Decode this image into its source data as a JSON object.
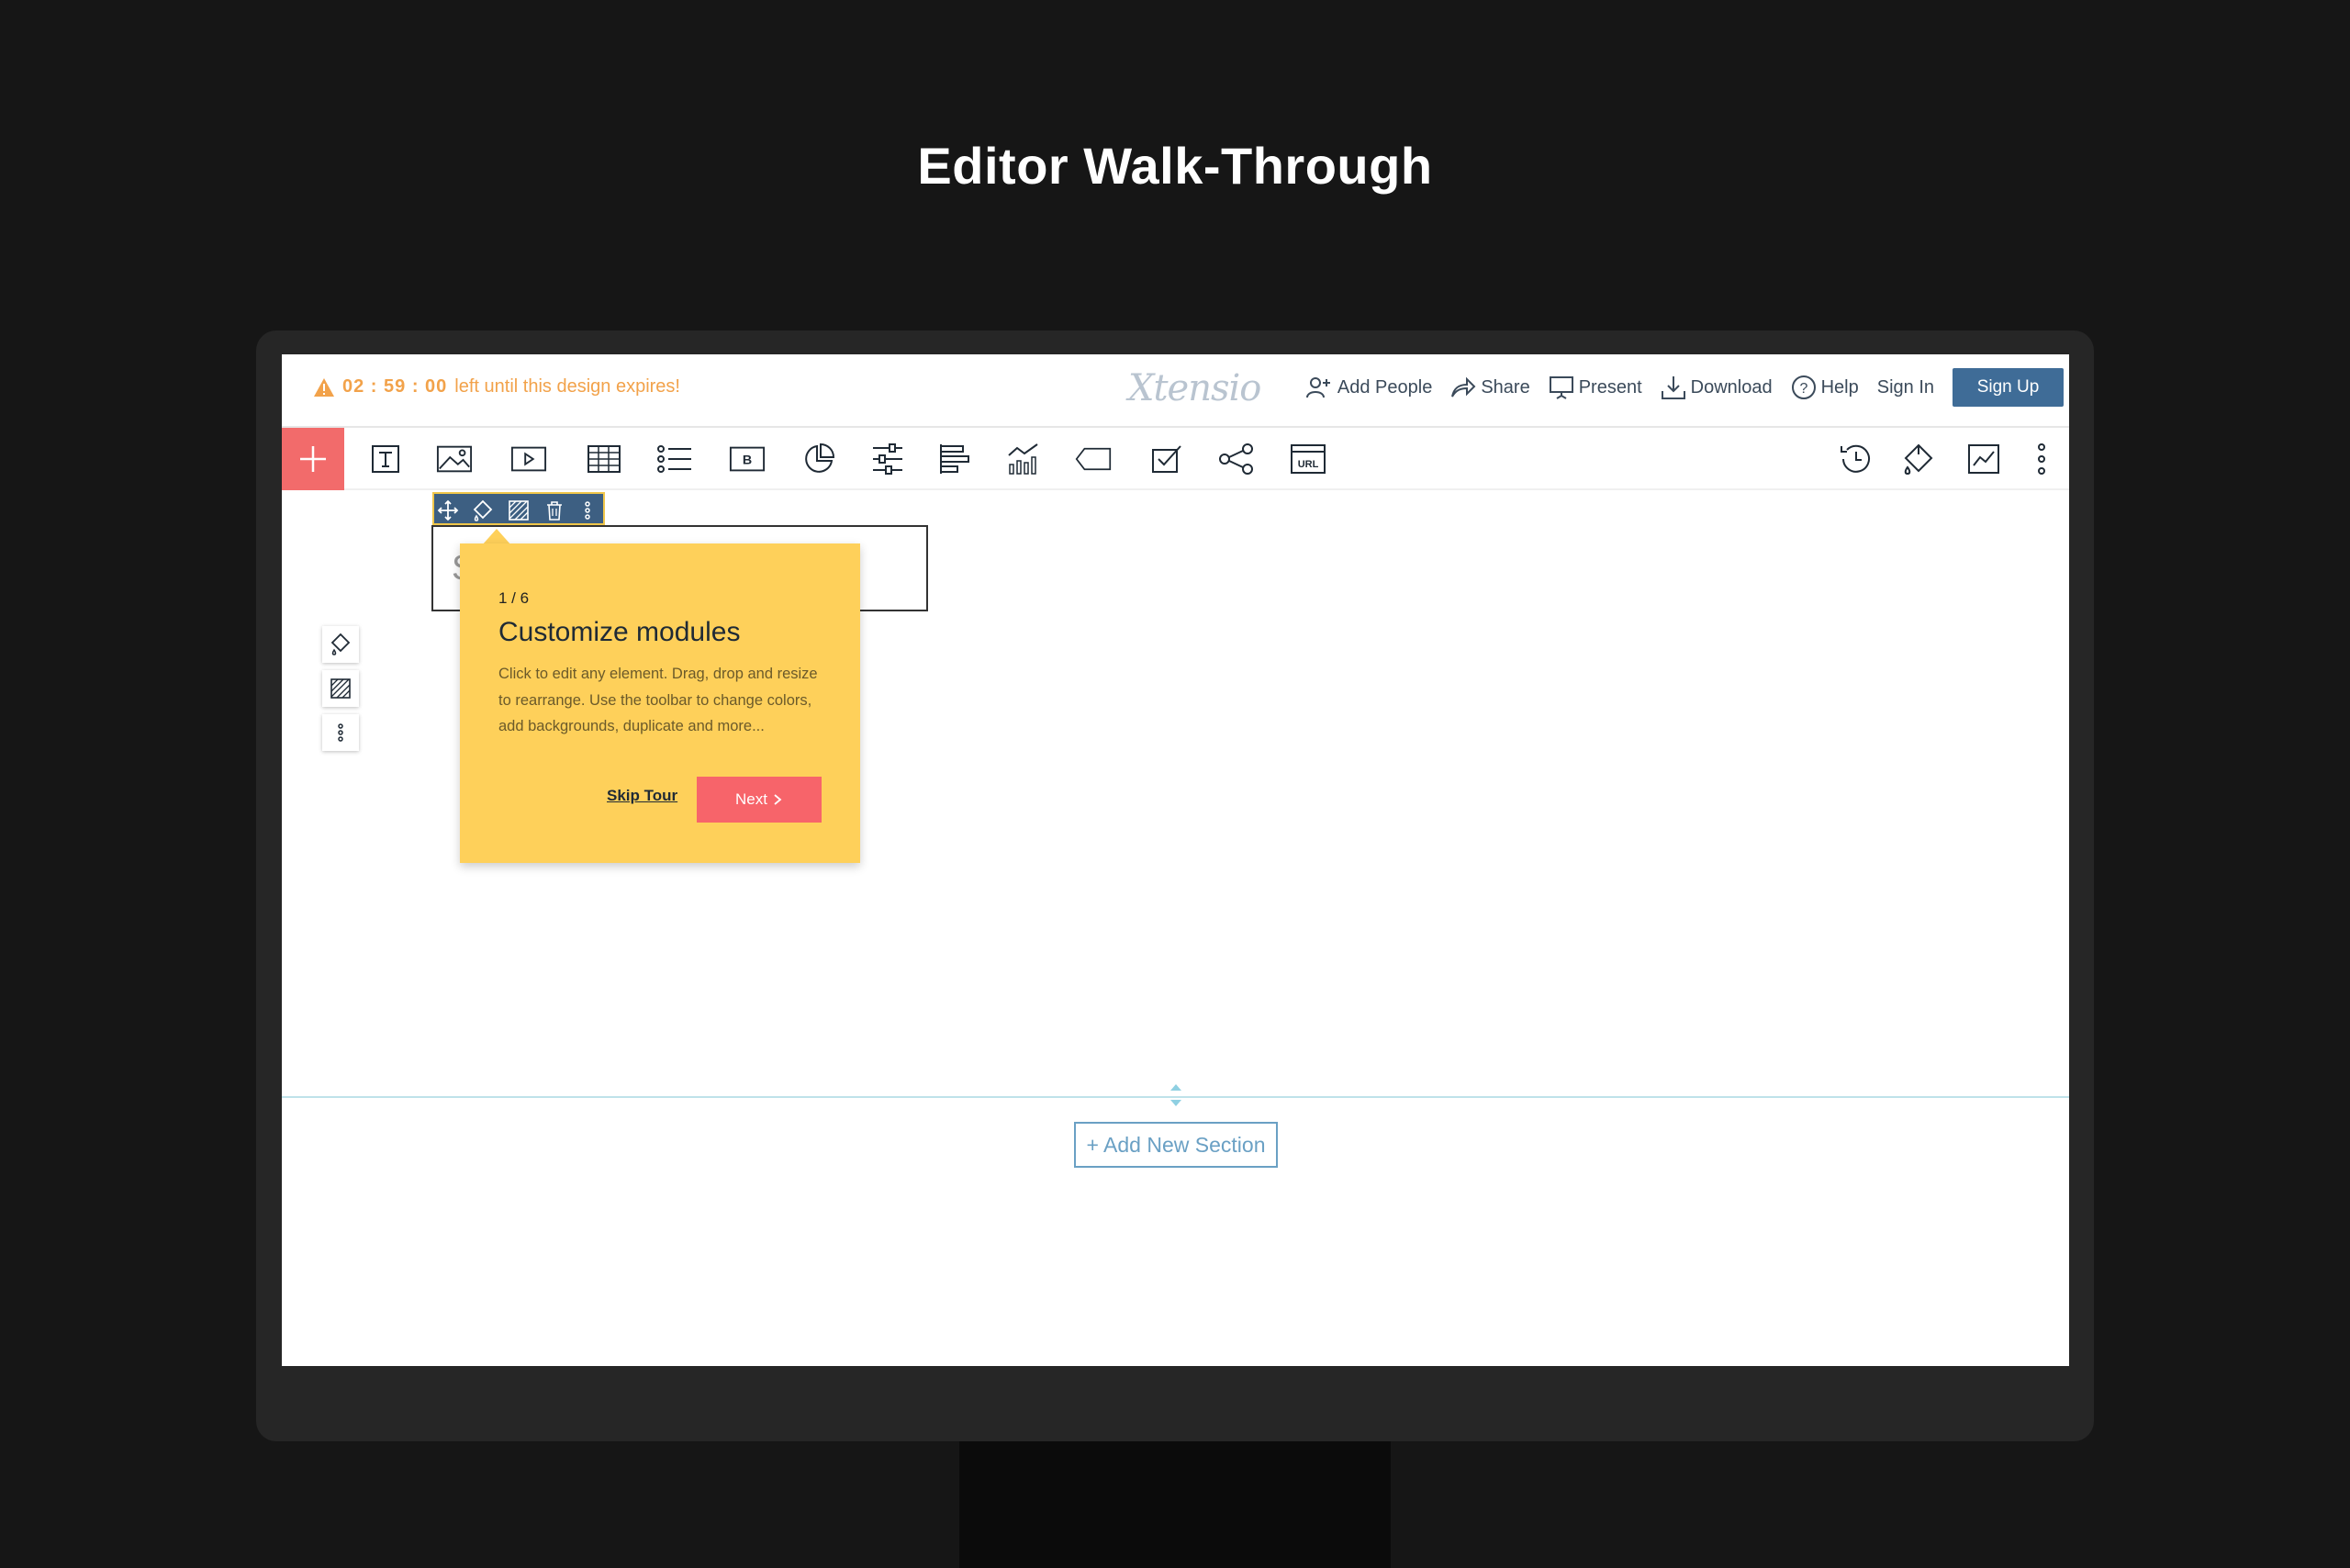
{
  "page": {
    "title": "Editor Walk-Through"
  },
  "topbar": {
    "timer": "02 : 59 : 00",
    "expiry_text": "left until this design expires!",
    "logo": "Xtensio",
    "nav": {
      "add_people": "Add People",
      "share": "Share",
      "present": "Present",
      "download": "Download",
      "help": "Help",
      "sign_in": "Sign In",
      "sign_up": "Sign Up"
    }
  },
  "toolbar": {
    "tools": [
      "text-icon",
      "image-icon",
      "video-icon",
      "table-icon",
      "list-icon",
      "button-icon",
      "pie-chart-icon",
      "sliders-icon",
      "bar-align-icon",
      "line-chart-icon",
      "tag-icon",
      "checkbox-icon",
      "share-nodes-icon",
      "url-icon"
    ],
    "right_tools": [
      "history-icon",
      "paint-bucket-icon",
      "analytics-icon",
      "more-vertical-icon"
    ],
    "url_label": "URL",
    "button_label": "B"
  },
  "module": {
    "placeholder_char": "S"
  },
  "tour": {
    "step": "1 / 6",
    "heading": "Customize modules",
    "body": "Click to edit any element. Drag, drop and resize to rearrange. Use the toolbar to change colors, add backgrounds, duplicate and more...",
    "skip": "Skip Tour",
    "next": "Next"
  },
  "canvas": {
    "add_section": "+ Add New Section"
  },
  "colors": {
    "accent_red": "#f26b6b",
    "tour_yellow": "#fed05a",
    "signup_blue": "#3f6c97",
    "expiry_orange": "#f2a24a"
  }
}
